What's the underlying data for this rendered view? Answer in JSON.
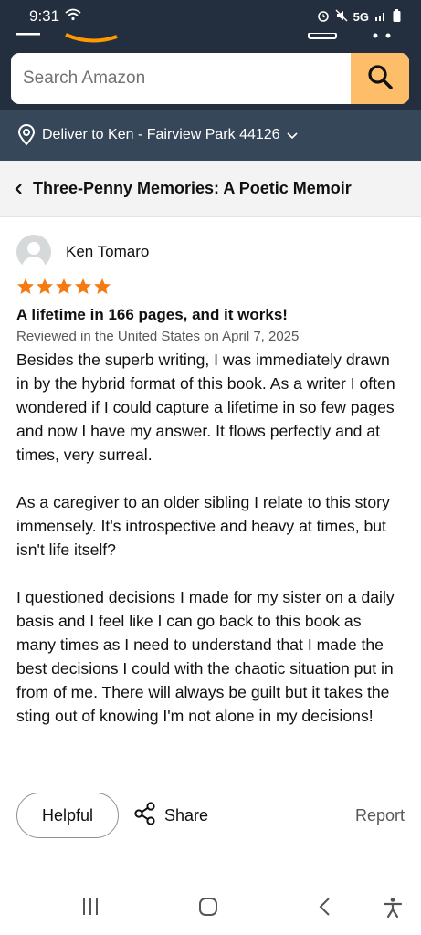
{
  "status_bar": {
    "time": "9:31",
    "network": "5G"
  },
  "search": {
    "placeholder": "Search Amazon"
  },
  "delivery": {
    "label": "Deliver to Ken - Fairview Park 44126"
  },
  "product": {
    "title": "Three-Penny Memories: A Poetic Memoir"
  },
  "review": {
    "reviewer_name": "Ken Tomaro",
    "rating": 5,
    "rating_max": 5,
    "title": "A lifetime in 166 pages, and it works!",
    "date": "Reviewed in the United States on April 7, 2025",
    "paragraphs": [
      "Besides the superb writing, I was immediately drawn in by the hybrid format of this book. As a writer I often wondered if I could capture a lifetime in so few pages and now I have my answer. It flows perfectly and at times, very surreal.",
      "As a caregiver to an older sibling I relate to this story immensely. It's introspective and heavy at times, but isn't life itself?",
      "I questioned decisions I made for my sister on a daily basis and I feel like I can go back to this book as many times as I need to understand that I made the best decisions I could with the chaotic situation put in from of me. There will always be guilt but it takes the sting out of knowing I'm not alone in my decisions!"
    ]
  },
  "actions": {
    "helpful_label": "Helpful",
    "share_label": "Share",
    "report_label": "Report"
  },
  "colors": {
    "header_bg": "#232f3e",
    "deliver_bg": "#37475a",
    "search_button": "#febd69",
    "star": "#f57a12"
  },
  "icons": {
    "search": "search-icon",
    "location": "location-pin-icon",
    "back": "chevron-left-icon",
    "share": "share-icon"
  }
}
